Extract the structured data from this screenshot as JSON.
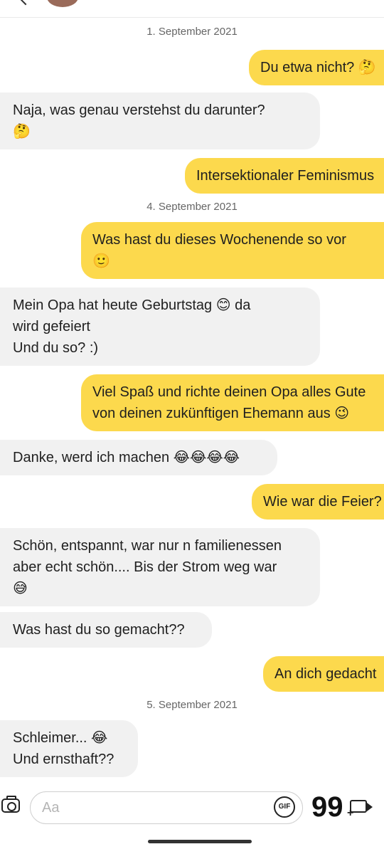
{
  "header": {
    "avatar": "avatar",
    "back_icon": "chevron-left-icon"
  },
  "messages": [
    {
      "type": "date",
      "text": "1. September 2021"
    },
    {
      "type": "out",
      "lines": [
        "Du etwa nicht? 🤔"
      ]
    },
    {
      "type": "in",
      "lines": [
        "Naja, was genau verstehst du darunter?",
        "🤔"
      ]
    },
    {
      "type": "out",
      "lines": [
        "Intersektionaler Feminismus"
      ]
    },
    {
      "type": "date",
      "text": "4. September 2021"
    },
    {
      "type": "out",
      "lines": [
        "Was hast du dieses Wochenende so vor",
        "🙂"
      ]
    },
    {
      "type": "in",
      "lines": [
        "Mein Opa hat heute Geburtstag 😊 da",
        "wird gefeiert",
        "Und du so? :)"
      ]
    },
    {
      "type": "out",
      "lines": [
        "Viel Spaß und richte deinen Opa alles Gute",
        "von deinen zukünftigen Ehemann aus 😉"
      ]
    },
    {
      "type": "in",
      "lines": [
        "Danke, werd ich machen 😂😂😂😂"
      ]
    },
    {
      "type": "out",
      "lines": [
        "Wie war die Feier?"
      ]
    },
    {
      "type": "in",
      "lines": [
        "Schön, entspannt, war nur n familienessen",
        "aber echt schön.... Bis der Strom weg war",
        "😅"
      ]
    },
    {
      "type": "in",
      "lines": [
        "Was hast du so gemacht??"
      ]
    },
    {
      "type": "out",
      "lines": [
        "An dich gedacht"
      ]
    },
    {
      "type": "date",
      "text": "5. September 2021"
    },
    {
      "type": "in",
      "lines": [
        "Schleimer... 😂",
        "Und ernsthaft??"
      ]
    }
  ],
  "composer": {
    "placeholder": "Aa",
    "gif_label": "GIF",
    "quote_glyph": "99",
    "plus_glyph": "+"
  }
}
